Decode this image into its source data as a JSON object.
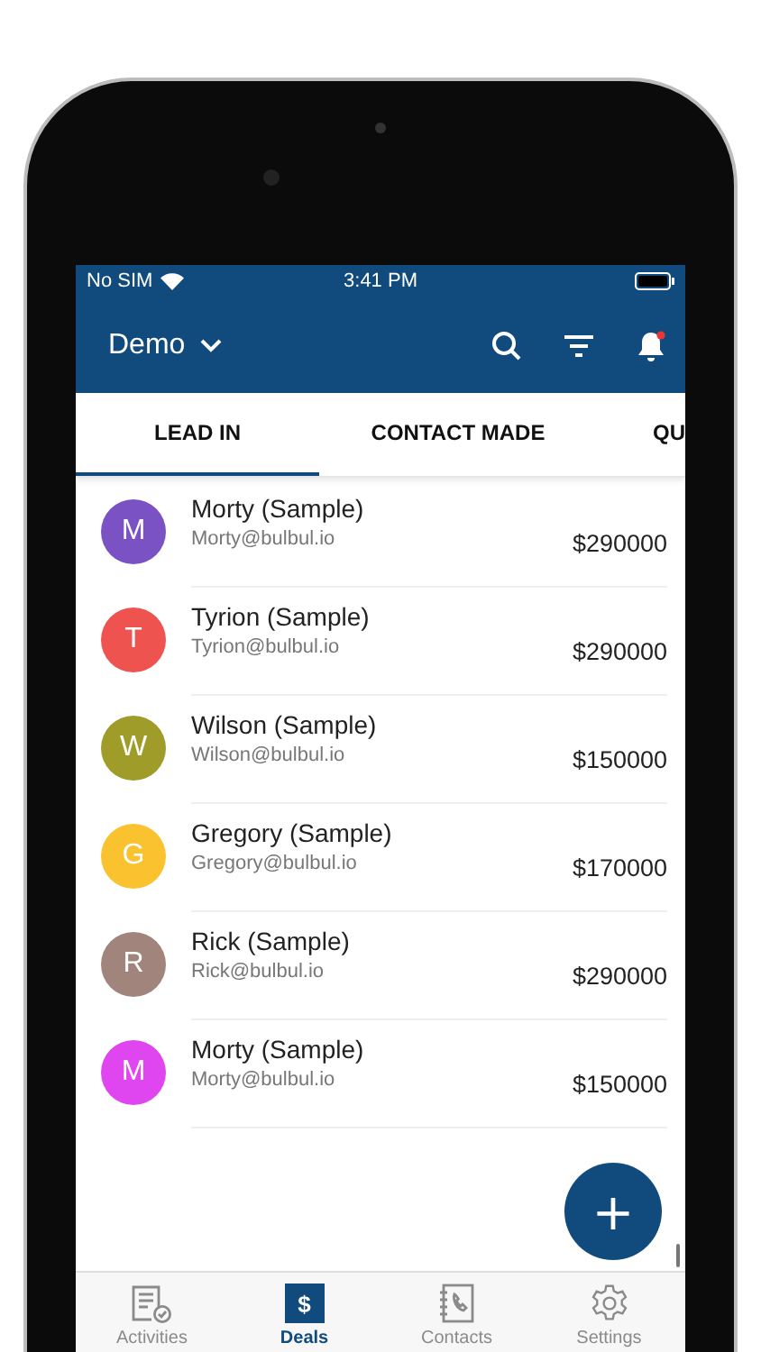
{
  "status_bar": {
    "carrier": "No SIM",
    "time": "3:41 PM"
  },
  "header": {
    "title": "Demo",
    "notification_dot": true
  },
  "tabs": [
    {
      "label": "LEAD IN",
      "selected": true
    },
    {
      "label": "CONTACT MADE",
      "selected": false
    },
    {
      "label": "QU",
      "selected": false
    }
  ],
  "deals": [
    {
      "initial": "M",
      "name": "Morty (Sample)",
      "email": "Morty@bulbul.io",
      "amount": "$290000",
      "color": "#7b52c4"
    },
    {
      "initial": "T",
      "name": "Tyrion (Sample)",
      "email": "Tyrion@bulbul.io",
      "amount": "$290000",
      "color": "#ee5350"
    },
    {
      "initial": "W",
      "name": "Wilson (Sample)",
      "email": "Wilson@bulbul.io",
      "amount": "$150000",
      "color": "#a09c2a"
    },
    {
      "initial": "G",
      "name": "Gregory (Sample)",
      "email": "Gregory@bulbul.io",
      "amount": "$170000",
      "color": "#f9c22e"
    },
    {
      "initial": "R",
      "name": "Rick (Sample)",
      "email": "Rick@bulbul.io",
      "amount": "$290000",
      "color": "#a1857c"
    },
    {
      "initial": "M",
      "name": "Morty (Sample)",
      "email": "Morty@bulbul.io",
      "amount": "$150000",
      "color": "#e046f0"
    }
  ],
  "fab": {
    "symbol": "+"
  },
  "bottom_nav": [
    {
      "kind": "activities",
      "label": "Activities",
      "selected": false
    },
    {
      "kind": "deals",
      "label": "Deals",
      "selected": true,
      "glyph": "$"
    },
    {
      "kind": "contacts",
      "label": "Contacts",
      "selected": false
    },
    {
      "kind": "settings",
      "label": "Settings",
      "selected": false
    }
  ]
}
